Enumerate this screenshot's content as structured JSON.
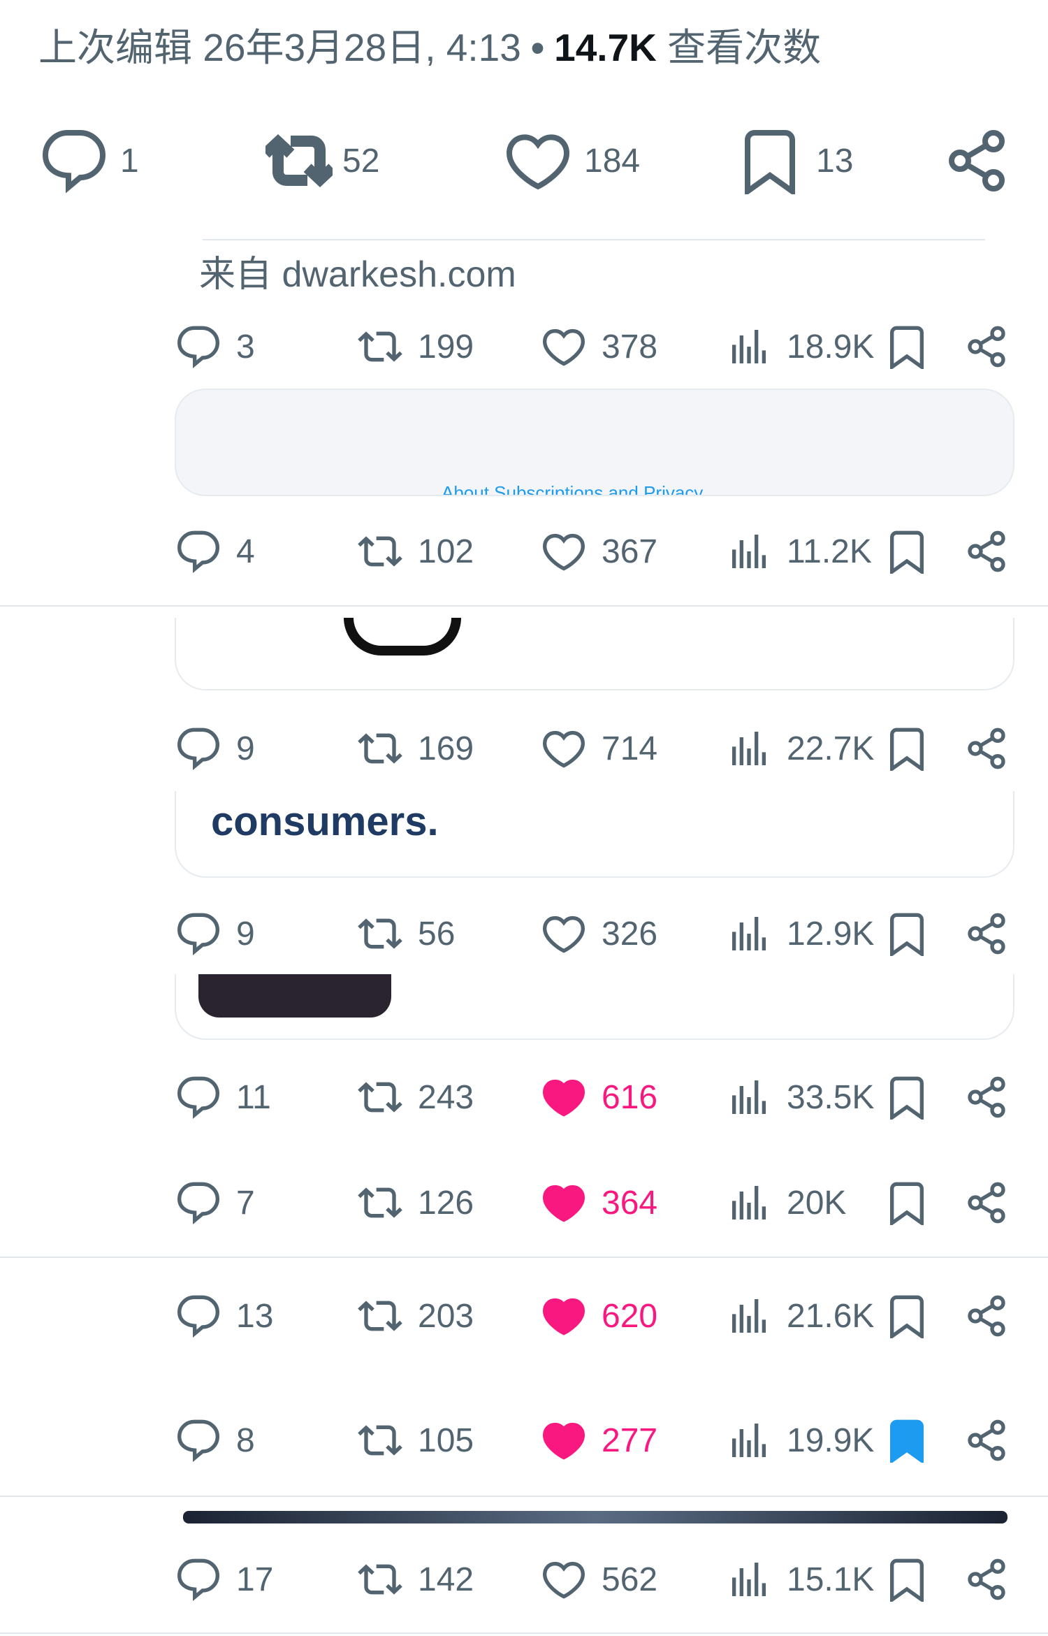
{
  "header": {
    "edited_label": "上次编辑 26年3月28日, 4:13",
    "separator": "•",
    "views_count": "14.7K",
    "views_label": "查看次数"
  },
  "main_post": {
    "replies": "1",
    "reposts": "52",
    "likes": "184",
    "bookmarks": "13"
  },
  "source": {
    "text": "来自 dwarkesh.com"
  },
  "cards": {
    "subscriptions_text": "About Subscriptions and Privacy",
    "consumers_text": "consumers."
  },
  "rows": [
    {
      "replies": "3",
      "reposts": "199",
      "likes": "378",
      "views": "18.9K",
      "liked": false,
      "bookmarked": false
    },
    {
      "replies": "4",
      "reposts": "102",
      "likes": "367",
      "views": "11.2K",
      "liked": false,
      "bookmarked": false
    },
    {
      "replies": "9",
      "reposts": "169",
      "likes": "714",
      "views": "22.7K",
      "liked": false,
      "bookmarked": false
    },
    {
      "replies": "9",
      "reposts": "56",
      "likes": "326",
      "views": "12.9K",
      "liked": false,
      "bookmarked": false
    },
    {
      "replies": "11",
      "reposts": "243",
      "likes": "616",
      "views": "33.5K",
      "liked": true,
      "bookmarked": false
    },
    {
      "replies": "7",
      "reposts": "126",
      "likes": "364",
      "views": "20K",
      "liked": true,
      "bookmarked": false
    },
    {
      "replies": "13",
      "reposts": "203",
      "likes": "620",
      "views": "21.6K",
      "liked": true,
      "bookmarked": false
    },
    {
      "replies": "8",
      "reposts": "105",
      "likes": "277",
      "views": "19.9K",
      "liked": true,
      "bookmarked": true
    },
    {
      "replies": "17",
      "reposts": "142",
      "likes": "562",
      "views": "15.1K",
      "liked": false,
      "bookmarked": false
    }
  ],
  "colors": {
    "text_secondary": "#536471",
    "like_active": "#f91880",
    "bookmark_active": "#1d9bf0"
  },
  "icons": {
    "reply": "reply-icon",
    "repost": "repost-icon",
    "like": "heart-icon",
    "views": "views-chart-icon",
    "bookmark": "bookmark-icon",
    "share": "share-icon"
  }
}
